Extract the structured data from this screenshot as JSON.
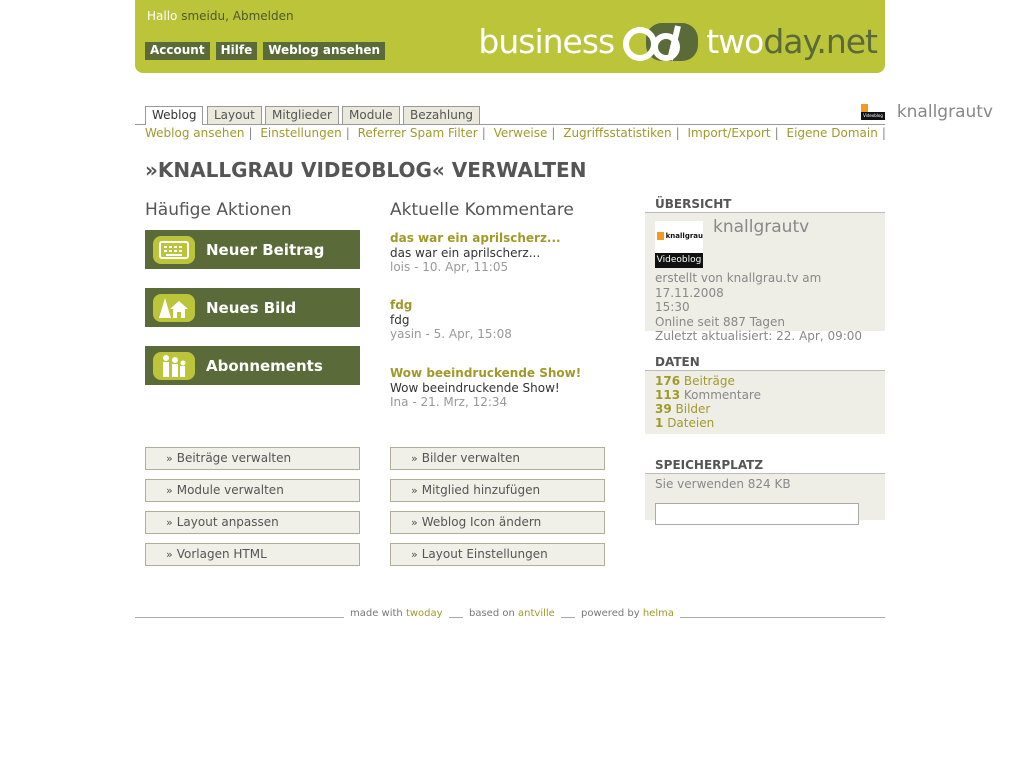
{
  "header": {
    "greeting": "Hallo",
    "username": "smeidu",
    "logout": "Abmelden",
    "nav": [
      "Account",
      "Hilfe",
      "Weblog ansehen"
    ],
    "logo_left": "business",
    "logo_right_a": "two",
    "logo_right_b": "day.net",
    "colors": {
      "brand_green": "#bcc43a",
      "dark_green": "#5a6a38"
    }
  },
  "tabs": [
    {
      "label": "Weblog",
      "active": true
    },
    {
      "label": "Layout",
      "active": false
    },
    {
      "label": "Mitglieder",
      "active": false
    },
    {
      "label": "Module",
      "active": false
    },
    {
      "label": "Bezahlung",
      "active": false
    }
  ],
  "blog_short_name": "knallgrautv",
  "blog_icon_caption": "Videoblog",
  "subnav": [
    "Weblog ansehen",
    "Einstellungen",
    "Referrer Spam Filter",
    "Verweise",
    "Zugriffsstatistiken",
    "Import/Export",
    "Eigene Domain"
  ],
  "subnav_separator": "|",
  "page_title": "»KNALLGRAU VIDEOBLOG« VERWALTEN",
  "actions": {
    "title": "Häufige Aktionen",
    "items": [
      {
        "label": "Neuer Beitrag",
        "icon": "typewriter-icon"
      },
      {
        "label": "Neues Bild",
        "icon": "landscape-icon"
      },
      {
        "label": "Abonnements",
        "icon": "people-icon"
      }
    ]
  },
  "comments": {
    "title": "Aktuelle Kommentare",
    "items": [
      {
        "title": "das war ein aprilscherz...",
        "body": "das war ein aprilscherz...",
        "meta": "lois - 10. Apr, 11:05"
      },
      {
        "title": "fdg",
        "body": "fdg",
        "meta": "yasin - 5. Apr, 15:08"
      },
      {
        "title": "Wow beeindruckende Show!",
        "body": "Wow beeindruckende Show!",
        "meta": "Ina - 21. Mrz, 12:34"
      }
    ]
  },
  "links": {
    "chevron": "»",
    "left": [
      "Beiträge verwalten",
      "Module verwalten",
      "Layout anpassen",
      "Vorlagen HTML"
    ],
    "right": [
      "Bilder verwalten",
      "Mitglied hinzufügen",
      "Weblog Icon ändern",
      "Layout Einstellungen"
    ]
  },
  "sidebar": {
    "overview": {
      "title": "ÜBERSICHT",
      "name": "knallgrautv",
      "icon_brand": "knallgrau",
      "icon_caption": "Videoblog",
      "lines": [
        "erstellt von knallgrau.tv am 17.11.2008",
        "15:30",
        "Online seit 887 Tagen",
        "Zuletzt aktualisiert: 22. Apr, 09:00"
      ]
    },
    "data": {
      "title": "DATEN",
      "items": [
        {
          "count": "176",
          "label": "Beiträge"
        },
        {
          "count": "113",
          "label": "Kommentare"
        },
        {
          "count": "39",
          "label": "Bilder"
        },
        {
          "count": "1",
          "label": "Dateien"
        }
      ]
    },
    "storage": {
      "title": "SPEICHERPLATZ",
      "text": "Sie verwenden 824 KB",
      "used_fraction": 0
    }
  },
  "footer": {
    "made_with": "made with",
    "made_with_link": "twoday",
    "based_on": "based on",
    "based_on_link": "antville",
    "powered_by": "powered by",
    "powered_by_link": "helma"
  }
}
